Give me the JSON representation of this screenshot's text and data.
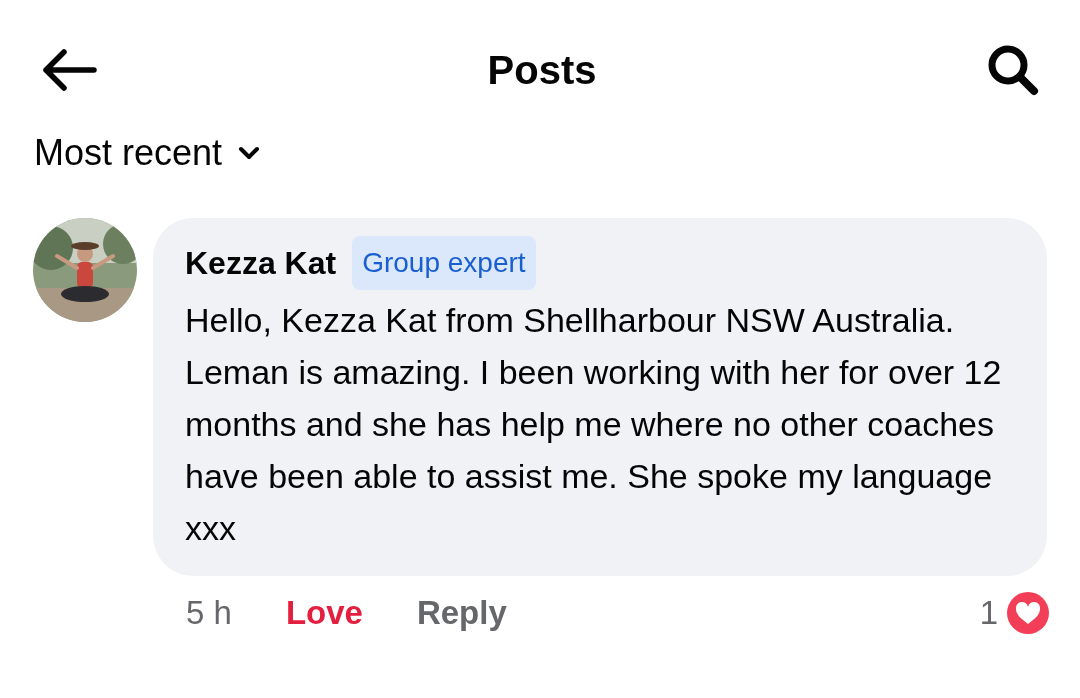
{
  "header": {
    "title": "Posts"
  },
  "sort": {
    "label": "Most recent"
  },
  "comment": {
    "author": "Kezza Kat",
    "badge": "Group expert",
    "text": "Hello, Kezza Kat from Shellharbour NSW Australia. Leman is amazing. I been working with her for over 12 months and she has help me where no other coaches have been able to assist me. She spoke my language xxx",
    "time": "5 h",
    "reaction": {
      "label": "Love",
      "selected": true
    },
    "reply": "Reply",
    "reaction_count": "1"
  }
}
